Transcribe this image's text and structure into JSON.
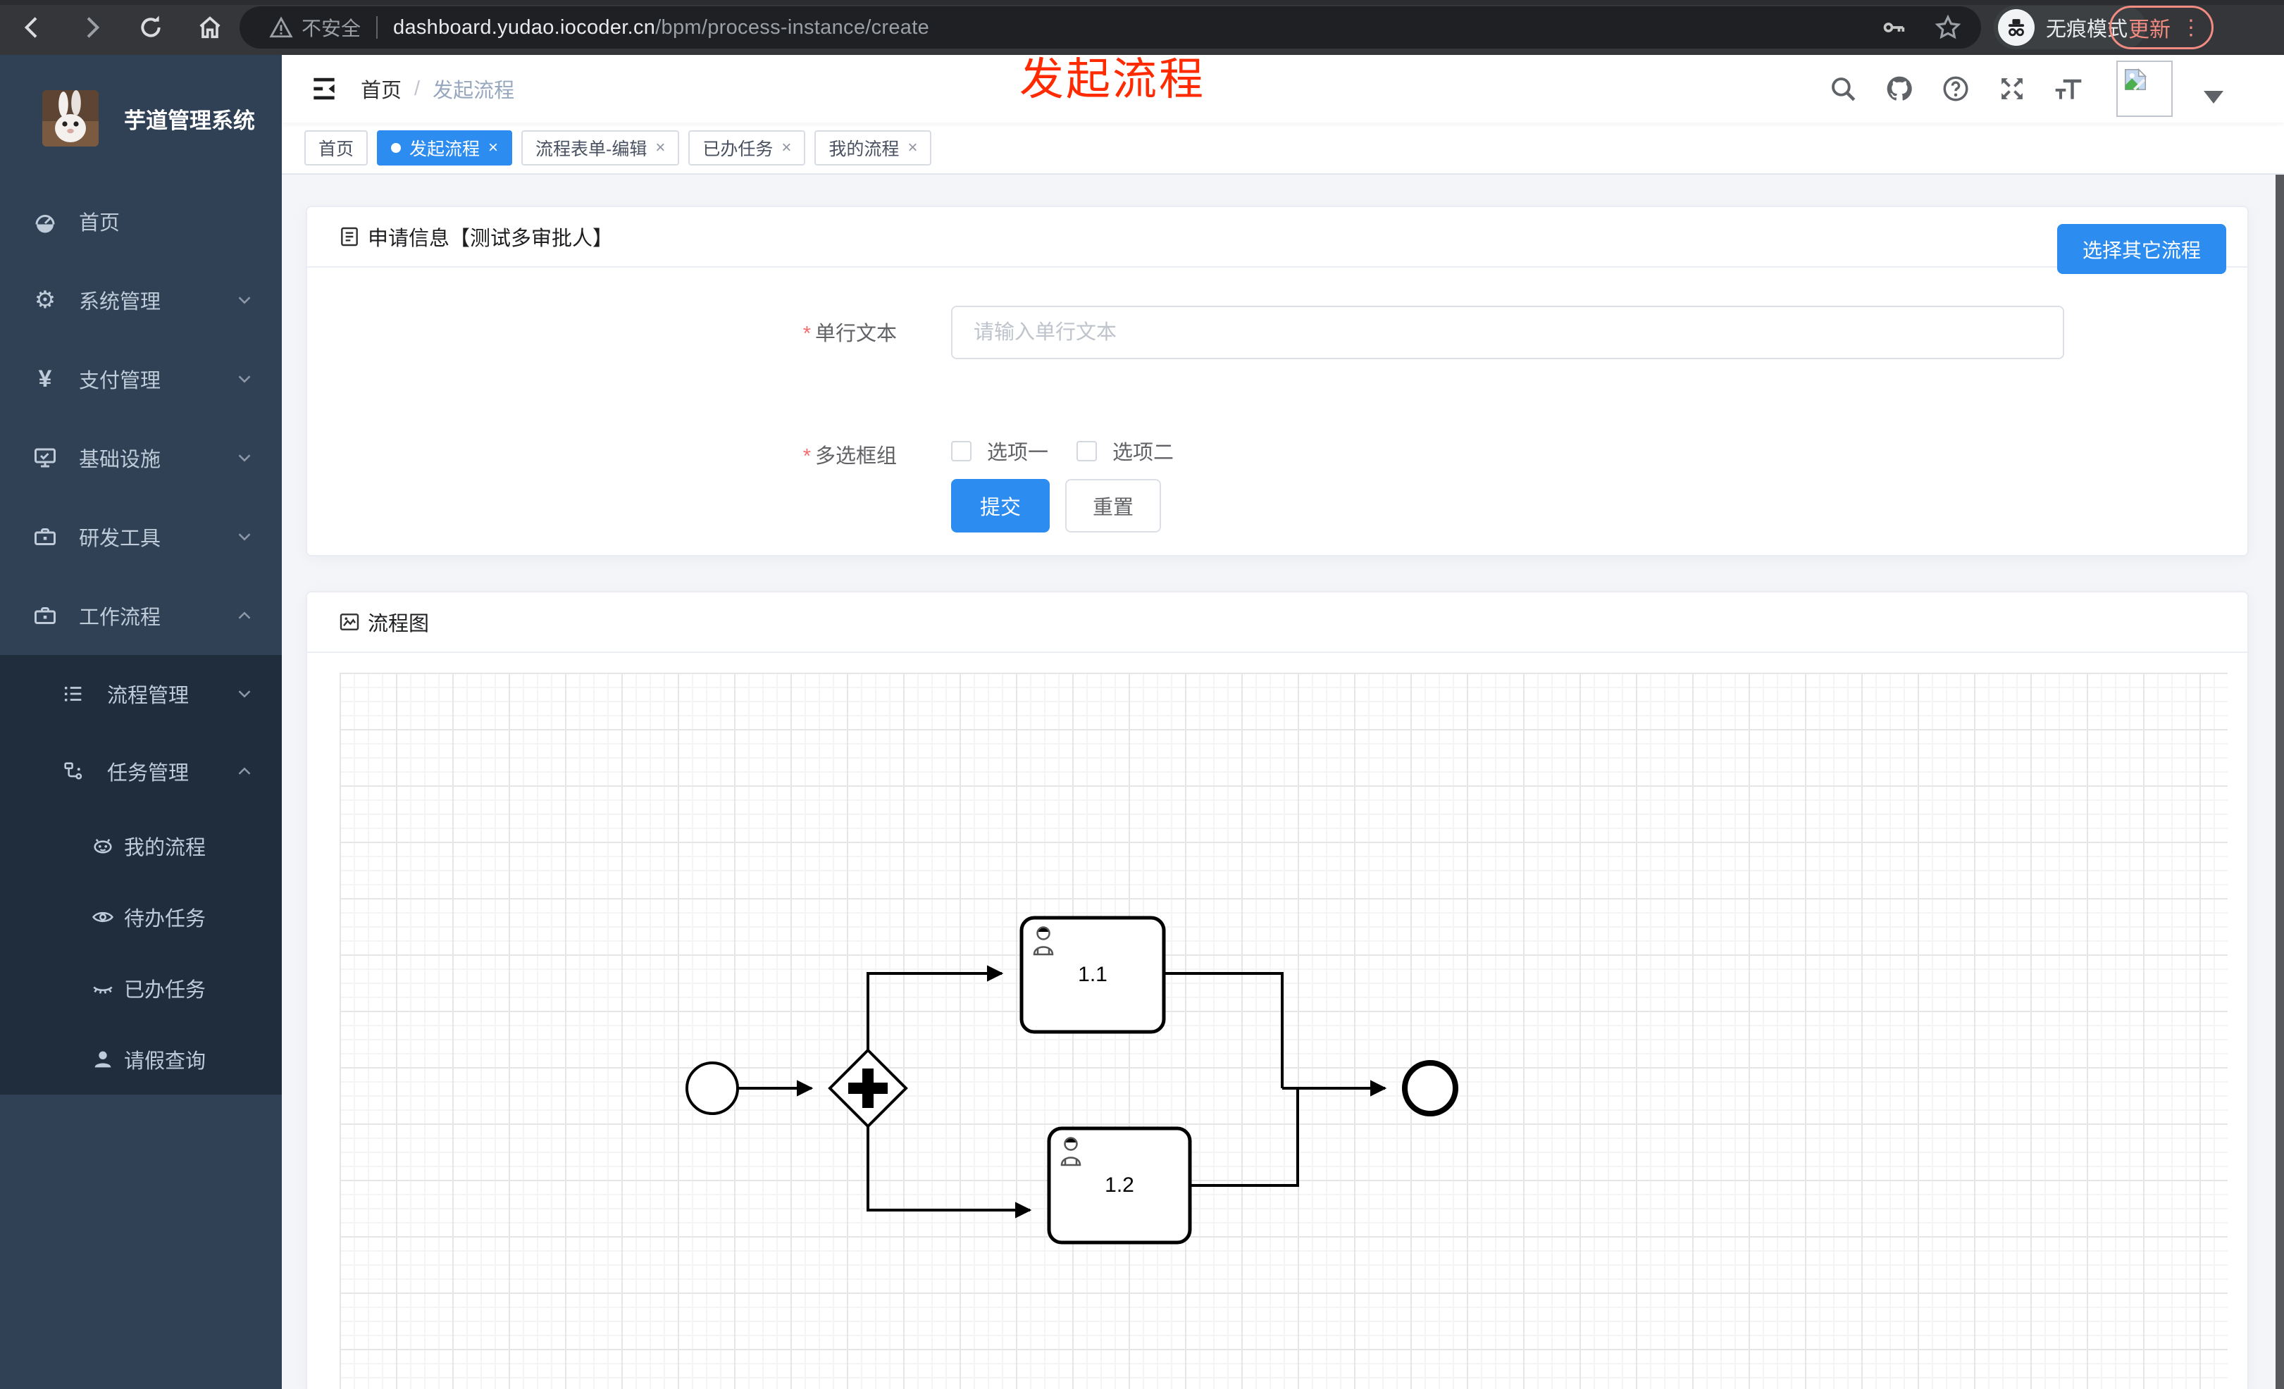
{
  "colors": {
    "accent": "#2d8cf0",
    "annotation_red": "#ff2a00",
    "sidebar_bg": "#304156",
    "submenu_bg": "#1f2d3d",
    "chrome_bg": "#35363a",
    "update_red": "#f28b82",
    "required_red": "#f56c6c"
  },
  "browser": {
    "security_label": "不安全",
    "url_host": "dashboard.yudao.iocoder.cn",
    "url_path": "/bpm/process-instance/create",
    "incognito_label": "无痕模式",
    "update_label": "更新",
    "menu_dots": "⋮"
  },
  "annotation": {
    "text": "发起流程"
  },
  "sidebar": {
    "title": "芋道管理系统",
    "items": [
      {
        "label": "首页"
      },
      {
        "label": "系统管理"
      },
      {
        "label": "支付管理"
      },
      {
        "label": "基础设施"
      },
      {
        "label": "研发工具"
      },
      {
        "label": "工作流程"
      },
      {
        "label": "流程管理"
      },
      {
        "label": "任务管理"
      },
      {
        "label": "我的流程"
      },
      {
        "label": "待办任务"
      },
      {
        "label": "已办任务"
      },
      {
        "label": "请假查询"
      }
    ]
  },
  "header": {
    "breadcrumb_home": "首页",
    "breadcrumb_sep": "/",
    "breadcrumb_current": "发起流程"
  },
  "tabs": [
    {
      "label": "首页"
    },
    {
      "label": "发起流程",
      "close": "×"
    },
    {
      "label": "流程表单-编辑",
      "close": "×"
    },
    {
      "label": "已办任务",
      "close": "×"
    },
    {
      "label": "我的流程",
      "close": "×"
    }
  ],
  "form_card": {
    "title": "申请信息【测试多审批人】",
    "choose_button": "选择其它流程",
    "field_text": {
      "label": "单行文本",
      "required": "*",
      "placeholder": "请输入单行文本"
    },
    "field_checkbox": {
      "label": "多选框组",
      "required": "*",
      "options": [
        {
          "label": "选项一"
        },
        {
          "label": "选项二"
        }
      ]
    },
    "submit_button": "提交",
    "reset_button": "重置"
  },
  "diagram_card": {
    "title": "流程图",
    "tasks": [
      {
        "label": "1.1"
      },
      {
        "label": "1.2"
      }
    ]
  }
}
